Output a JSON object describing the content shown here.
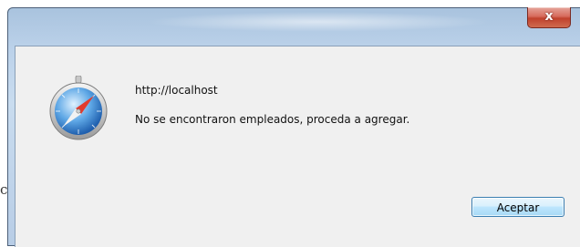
{
  "background_fragment": "c",
  "dialog": {
    "close_label": "x",
    "icon": "safari-compass-icon",
    "url": "http://localhost",
    "message": "No se encontraron empleados, proceda a agregar.",
    "ok_label": "Aceptar"
  },
  "colors": {
    "title_bar": "#b8cde6",
    "body": "#f0f0f0",
    "close_button": "#c0412d",
    "ok_button": "#bee6fd"
  }
}
